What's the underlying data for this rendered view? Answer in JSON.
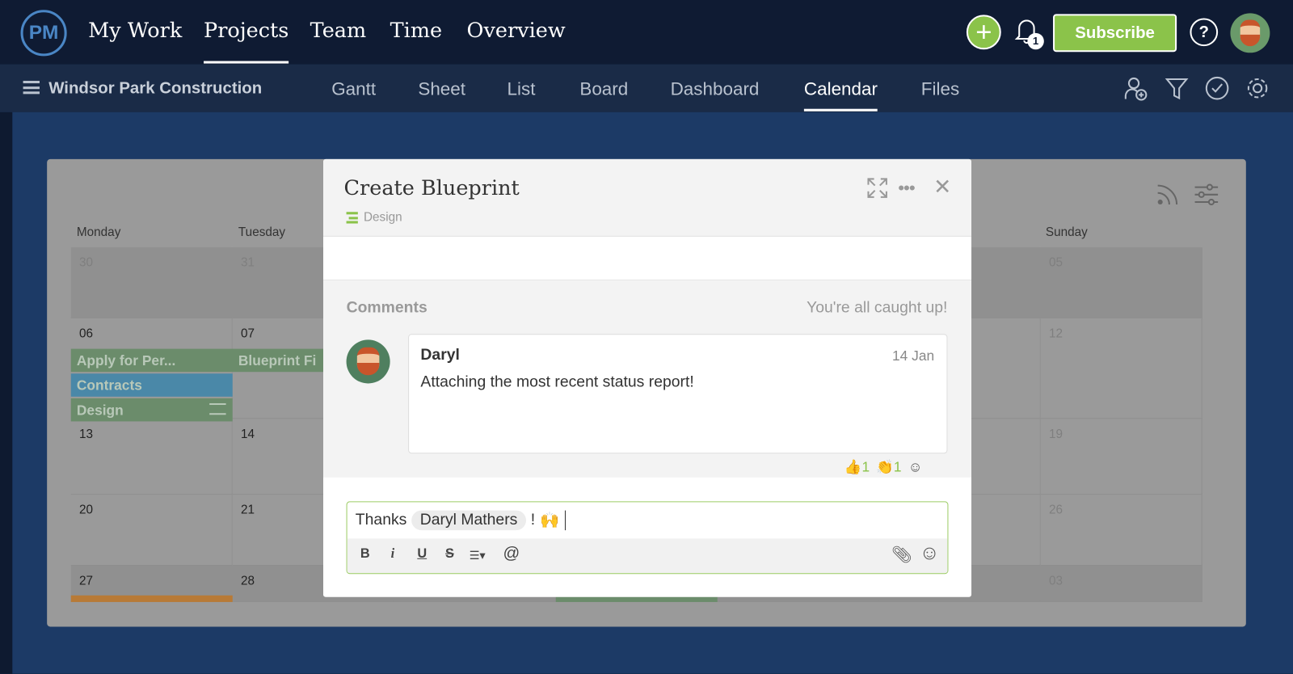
{
  "colors": {
    "brand": "#4a86c5",
    "accent": "#8bc34a",
    "contracts": "#4a88a8",
    "design": "#6b8c6b",
    "orange": "#b87a36"
  },
  "topnav": {
    "logo": "PM",
    "items": [
      "My Work",
      "Projects",
      "Team",
      "Time",
      "Overview"
    ],
    "active": "Projects",
    "subscribe": "Subscribe",
    "notification_count": "1"
  },
  "subnav": {
    "project": "Windsor Park Construction",
    "tabs": [
      "Gantt",
      "Sheet",
      "List",
      "Board",
      "Dashboard",
      "Calendar",
      "Files"
    ],
    "active": "Calendar"
  },
  "calendar": {
    "days": [
      "Monday",
      "Tuesday",
      "Sunday"
    ],
    "rows": [
      [
        "30",
        "31",
        "05"
      ],
      [
        "06",
        "07",
        "12"
      ],
      [
        "13",
        "14",
        "19"
      ],
      [
        "20",
        "21",
        "26"
      ],
      [
        "27",
        "28",
        "03"
      ]
    ],
    "events": [
      "Apply for Per...",
      "Blueprint Fi",
      "Contracts",
      "Design"
    ]
  },
  "modal": {
    "title": "Create Blueprint",
    "parent": "Design",
    "comments_label": "Comments",
    "caught_up": "You're all caught up!",
    "comment": {
      "author": "Daryl",
      "date": "14 Jan",
      "text": "Attaching the most recent status report!",
      "reactions": [
        {
          "icon": "thumbs-up",
          "count": "1"
        },
        {
          "icon": "clap",
          "count": "1"
        }
      ]
    },
    "editor": {
      "text_before": "Thanks",
      "mention": "Daryl Mathers",
      "text_after": "!",
      "emoji": "🙌",
      "toolbar": [
        "B",
        "i",
        "U",
        "S",
        "☰▾",
        "@"
      ]
    }
  }
}
